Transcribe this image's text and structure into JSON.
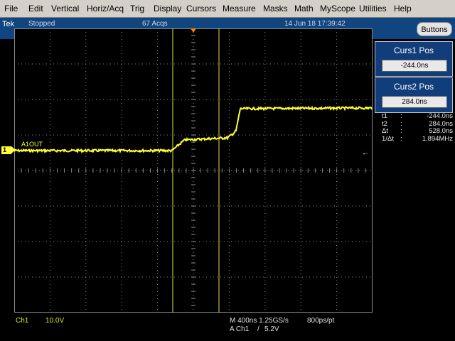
{
  "menu": {
    "items": [
      {
        "name": "file",
        "label": "File"
      },
      {
        "name": "edit",
        "label": "Edit"
      },
      {
        "name": "vertical",
        "label": "Vertical"
      },
      {
        "name": "horiz-acq",
        "label": "Horiz/Acq"
      },
      {
        "name": "trig",
        "label": "Trig"
      },
      {
        "name": "display",
        "label": "Display"
      },
      {
        "name": "cursors",
        "label": "Cursors"
      },
      {
        "name": "measure",
        "label": "Measure"
      },
      {
        "name": "masks",
        "label": "Masks"
      },
      {
        "name": "math",
        "label": "Math"
      },
      {
        "name": "myscope",
        "label": "MyScope"
      },
      {
        "name": "utilities",
        "label": "Utilities"
      },
      {
        "name": "help",
        "label": "Help"
      }
    ]
  },
  "status": {
    "brand": "Tek",
    "state": "Stopped",
    "acqs": "67 Acqs",
    "datetime": "14 Jun 18 17:39:42",
    "buttons_label": "Buttons"
  },
  "cursors": {
    "cursor1": {
      "title": "Curs1 Pos",
      "value": "-244.0ns"
    },
    "cursor2": {
      "title": "Curs2 Pos",
      "value": "284.0ns"
    },
    "readout": [
      {
        "key": "t1",
        "sep": ":",
        "value": "-244.0ns"
      },
      {
        "key": "t2",
        "sep": ":",
        "value": "284.0ns"
      },
      {
        "key": "Δt",
        "sep": ":",
        "value": "528.0ns"
      },
      {
        "key": "1/Δt",
        "sep": ":",
        "value": "1.894MHz"
      }
    ]
  },
  "channel": {
    "marker": "1",
    "label": "A1OUT",
    "name": "Ch1",
    "scale": "10.0V"
  },
  "horizontal": {
    "timebase": "M 400ns 1.25GS/s",
    "resolution": "800ps/pt",
    "trigger_source": "A  Ch1",
    "trigger_slope": "/",
    "trigger_level": "5.2V"
  },
  "colors": {
    "trace": "#ffff33",
    "cursor": "#e8d840",
    "grid": "#8a8a8a",
    "status_bg": "#10457f"
  }
}
